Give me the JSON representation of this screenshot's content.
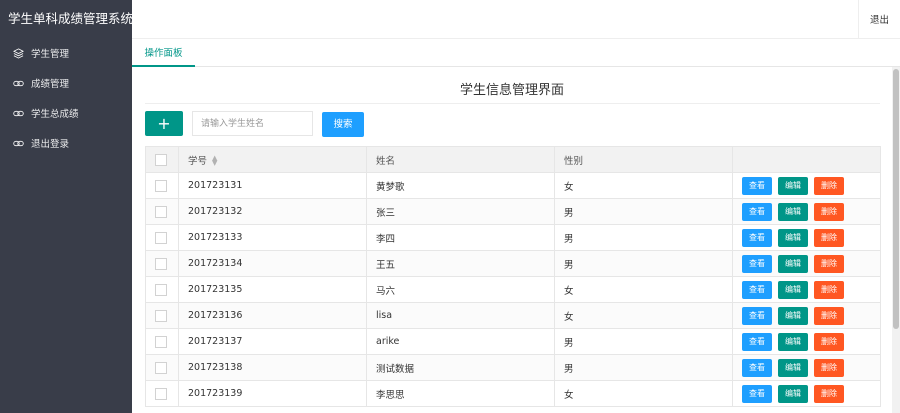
{
  "app": {
    "title": "学生单科成绩管理系统",
    "logout_top": "退出"
  },
  "sidebar": {
    "items": [
      {
        "label": "学生管理",
        "icon": "layers-icon"
      },
      {
        "label": "成绩管理",
        "icon": "link-icon"
      },
      {
        "label": "学生总成绩",
        "icon": "link-icon"
      },
      {
        "label": "退出登录",
        "icon": "link-icon"
      }
    ]
  },
  "tabs": [
    {
      "label": "操作面板",
      "active": true
    }
  ],
  "main": {
    "title": "学生信息管理界面",
    "add_label": "+",
    "search_placeholder": "请输入学生姓名",
    "search_label": "搜索"
  },
  "table": {
    "columns": [
      "学号",
      "姓名",
      "性别"
    ],
    "actions": {
      "view": "查看",
      "edit": "编辑",
      "delete": "删除"
    },
    "rows": [
      {
        "id": "201723131",
        "name": "黄梦歌",
        "gender": "女"
      },
      {
        "id": "201723132",
        "name": "张三",
        "gender": "男"
      },
      {
        "id": "201723133",
        "name": "李四",
        "gender": "男"
      },
      {
        "id": "201723134",
        "name": "王五",
        "gender": "男"
      },
      {
        "id": "201723135",
        "name": "马六",
        "gender": "女"
      },
      {
        "id": "201723136",
        "name": "lisa",
        "gender": "女"
      },
      {
        "id": "201723137",
        "name": "arike",
        "gender": "男"
      },
      {
        "id": "201723138",
        "name": "测试数据",
        "gender": "男"
      },
      {
        "id": "201723139",
        "name": "李思思",
        "gender": "女"
      }
    ]
  },
  "colors": {
    "sidebar_bg": "#393d49",
    "primary": "#009688",
    "blue": "#1e9fff",
    "danger": "#ff5722"
  }
}
